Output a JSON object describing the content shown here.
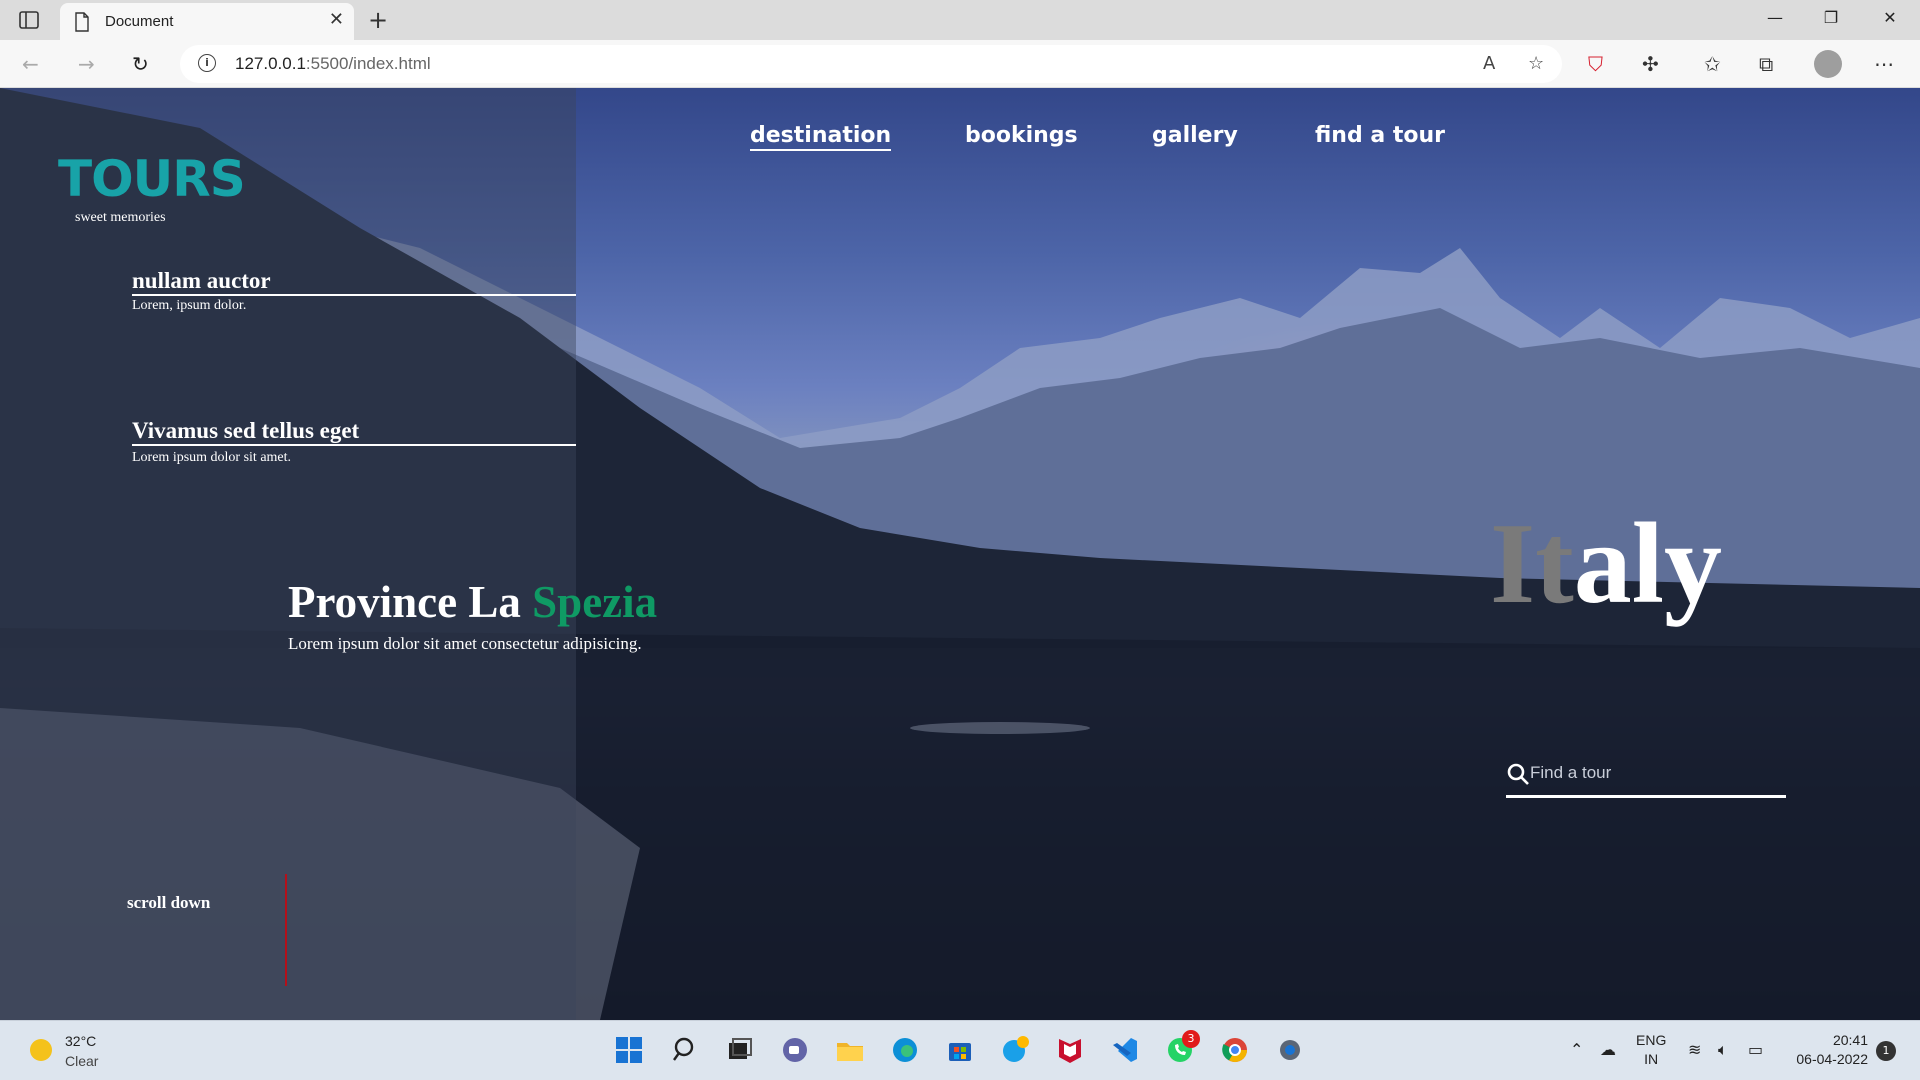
{
  "browser": {
    "tab_title": "Document",
    "url_host": "127.0.0.1",
    "url_rest": ":5500/index.html"
  },
  "site": {
    "logo": "TOURS",
    "tagline": "sweet memories",
    "nav": [
      "destination",
      "bookings",
      "gallery",
      "find a tour"
    ],
    "side_items": [
      {
        "title": "nullam auctor",
        "subtitle": "Lorem, ipsum dolor."
      },
      {
        "title": "Vivamus sed tellus eget",
        "subtitle": "Lorem ipsum dolor sit amet."
      }
    ],
    "province_text": "Province La ",
    "province_highlight": "Spezia",
    "province_sub": "Lorem ipsum dolor sit amet consectetur adipisicing.",
    "scroll": "scroll down",
    "hero_it": "It",
    "hero_rest": "aly",
    "search_placeholder": "Find a tour"
  },
  "taskbar": {
    "temp": "32°C",
    "condition": "Clear",
    "whatsapp_badge": "3",
    "lang_1": "ENG",
    "lang_2": "IN",
    "time": "20:41",
    "date": "06-04-2022",
    "notification_count": "1"
  },
  "colors": {
    "logo": "#18a3a8",
    "highlight": "#0f9a64",
    "scroll_line": "#b4101a"
  }
}
